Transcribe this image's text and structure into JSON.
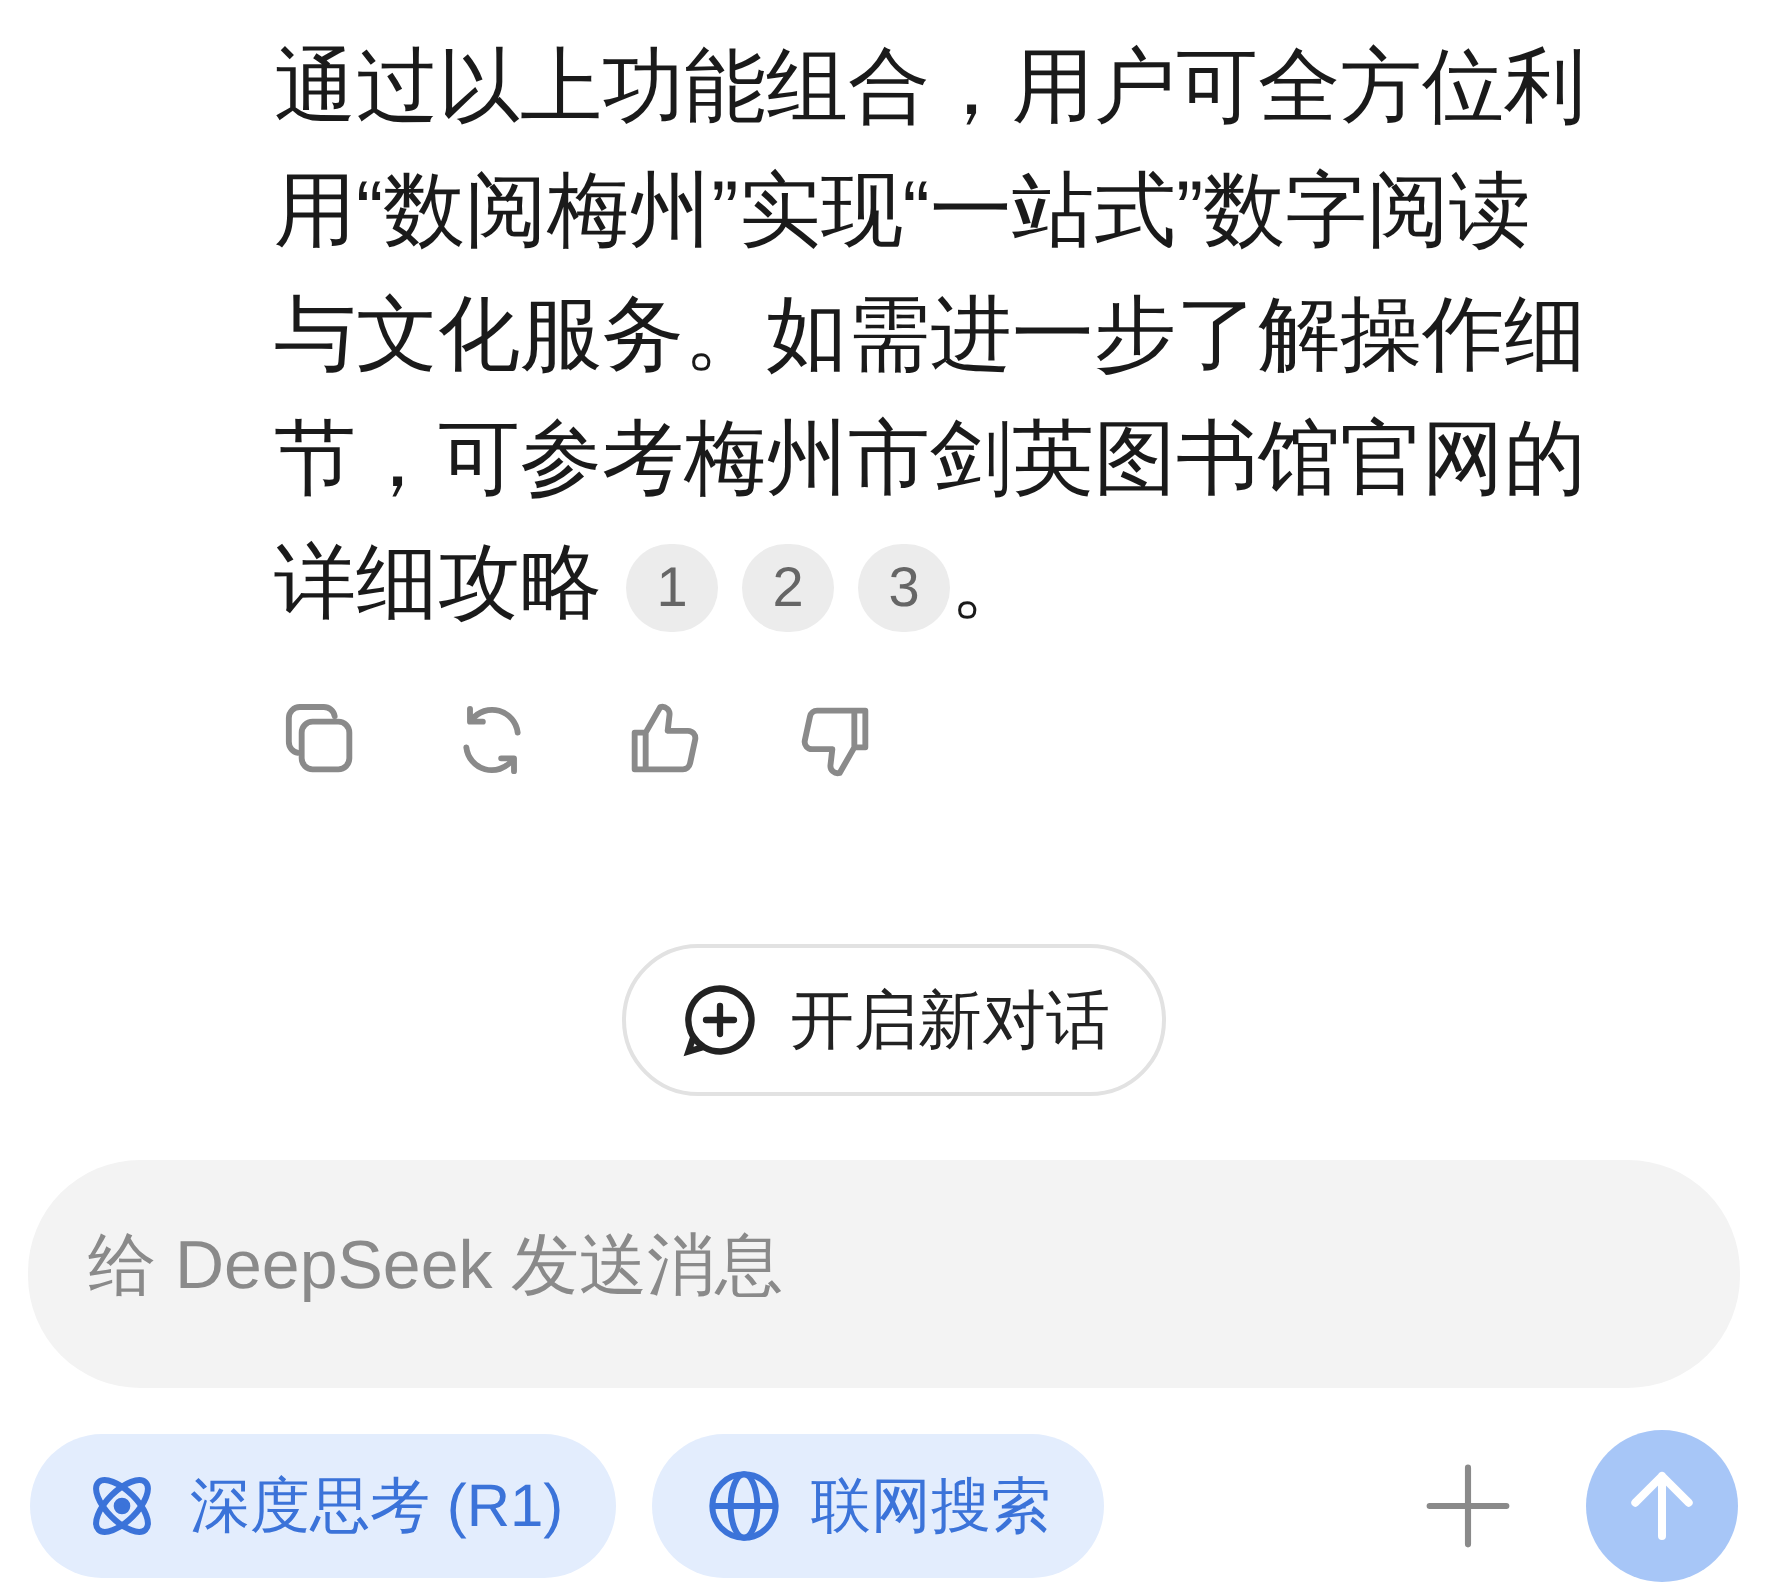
{
  "message": {
    "text": "通过以上功能组合，用户可全方位利用“数阅梅州”实现“一站式”数字阅读与文化服务。如需进一步了解操作细节，可参考梅州市剑英图书馆官网的详细攻略",
    "citations": [
      "1",
      "2",
      "3"
    ],
    "text_after": "。"
  },
  "actions": [
    {
      "kind": "copy"
    },
    {
      "kind": "regenerate"
    },
    {
      "kind": "like"
    },
    {
      "kind": "dislike"
    }
  ],
  "new_chat_button": {
    "label": "开启新对话"
  },
  "composer": {
    "placeholder": "给 DeepSeek 发送消息"
  },
  "toggles": [
    {
      "kind": "deepthink",
      "label": "深度思考 (R1)",
      "selected": true
    },
    {
      "kind": "search",
      "label": "联网搜索",
      "selected": true
    }
  ],
  "send_button": {
    "disabled": true
  }
}
